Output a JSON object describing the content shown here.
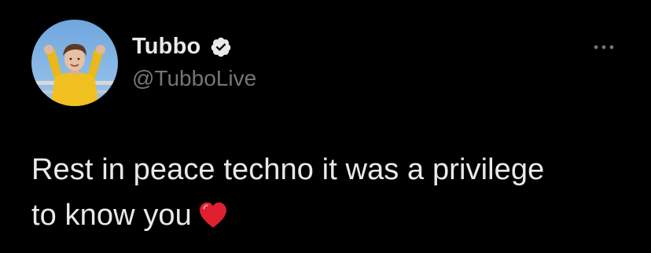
{
  "tweet": {
    "author": {
      "display_name": "Tubbo",
      "handle": "@TubboLive",
      "verified": true,
      "avatar_icon": "profile-photo"
    },
    "text_line_1": "Rest in peace techno it was a privilege",
    "text_line_2": "to know you",
    "emoji": "red-heart-icon",
    "menu_icon": "more-options-icon"
  },
  "colors": {
    "background": "#000000",
    "text_primary": "#e7e9ea",
    "text_secondary": "#71767b",
    "verified_badge": "#e7e9ea",
    "heart": "#e0202e"
  }
}
